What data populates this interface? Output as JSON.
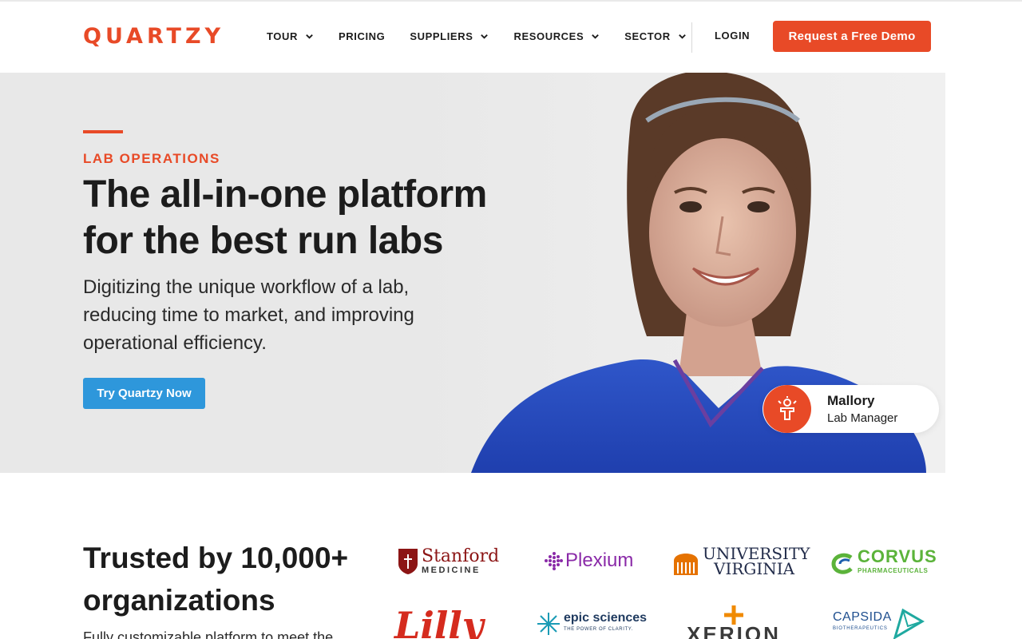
{
  "header": {
    "brand": "QUARTZY",
    "nav": [
      {
        "label": "TOUR",
        "dropdown": true
      },
      {
        "label": "PRICING",
        "dropdown": false
      },
      {
        "label": "SUPPLIERS",
        "dropdown": true
      },
      {
        "label": "RESOURCES",
        "dropdown": true
      },
      {
        "label": "SECTOR",
        "dropdown": true
      }
    ],
    "login": "LOGIN",
    "demo_button": "Request a Free Demo"
  },
  "hero": {
    "eyebrow": "LAB OPERATIONS",
    "title": "The all-in-one platform for the best run labs",
    "subtitle": "Digitizing the unique workflow of a lab, reducing time to market, and improving operational efficiency.",
    "cta": "Try Quartzy Now",
    "person": {
      "name": "Mallory",
      "role": "Lab Manager"
    }
  },
  "trusted": {
    "title": "Trusted by 10,000+ organizations",
    "subtitle": "Fully customizable platform to meet the",
    "logos": [
      {
        "name": "Stanford",
        "sub": "MEDICINE"
      },
      {
        "name": "Plexium",
        "sub": ""
      },
      {
        "name": "UNIVERSITY",
        "sub": "VIRGINIA"
      },
      {
        "name": "CORVUS",
        "sub": "PHARMACEUTICALS"
      },
      {
        "name": "Lilly",
        "sub": ""
      },
      {
        "name": "epic sciences",
        "sub": "THE POWER OF CLARITY."
      },
      {
        "name": "XERION",
        "sub": ""
      },
      {
        "name": "CAPSIDA",
        "sub": "BIOTHERAPEUTICS"
      }
    ]
  },
  "colors": {
    "brand": "#e84a27",
    "cta_blue": "#2e97db",
    "text": "#1c1c1c"
  }
}
